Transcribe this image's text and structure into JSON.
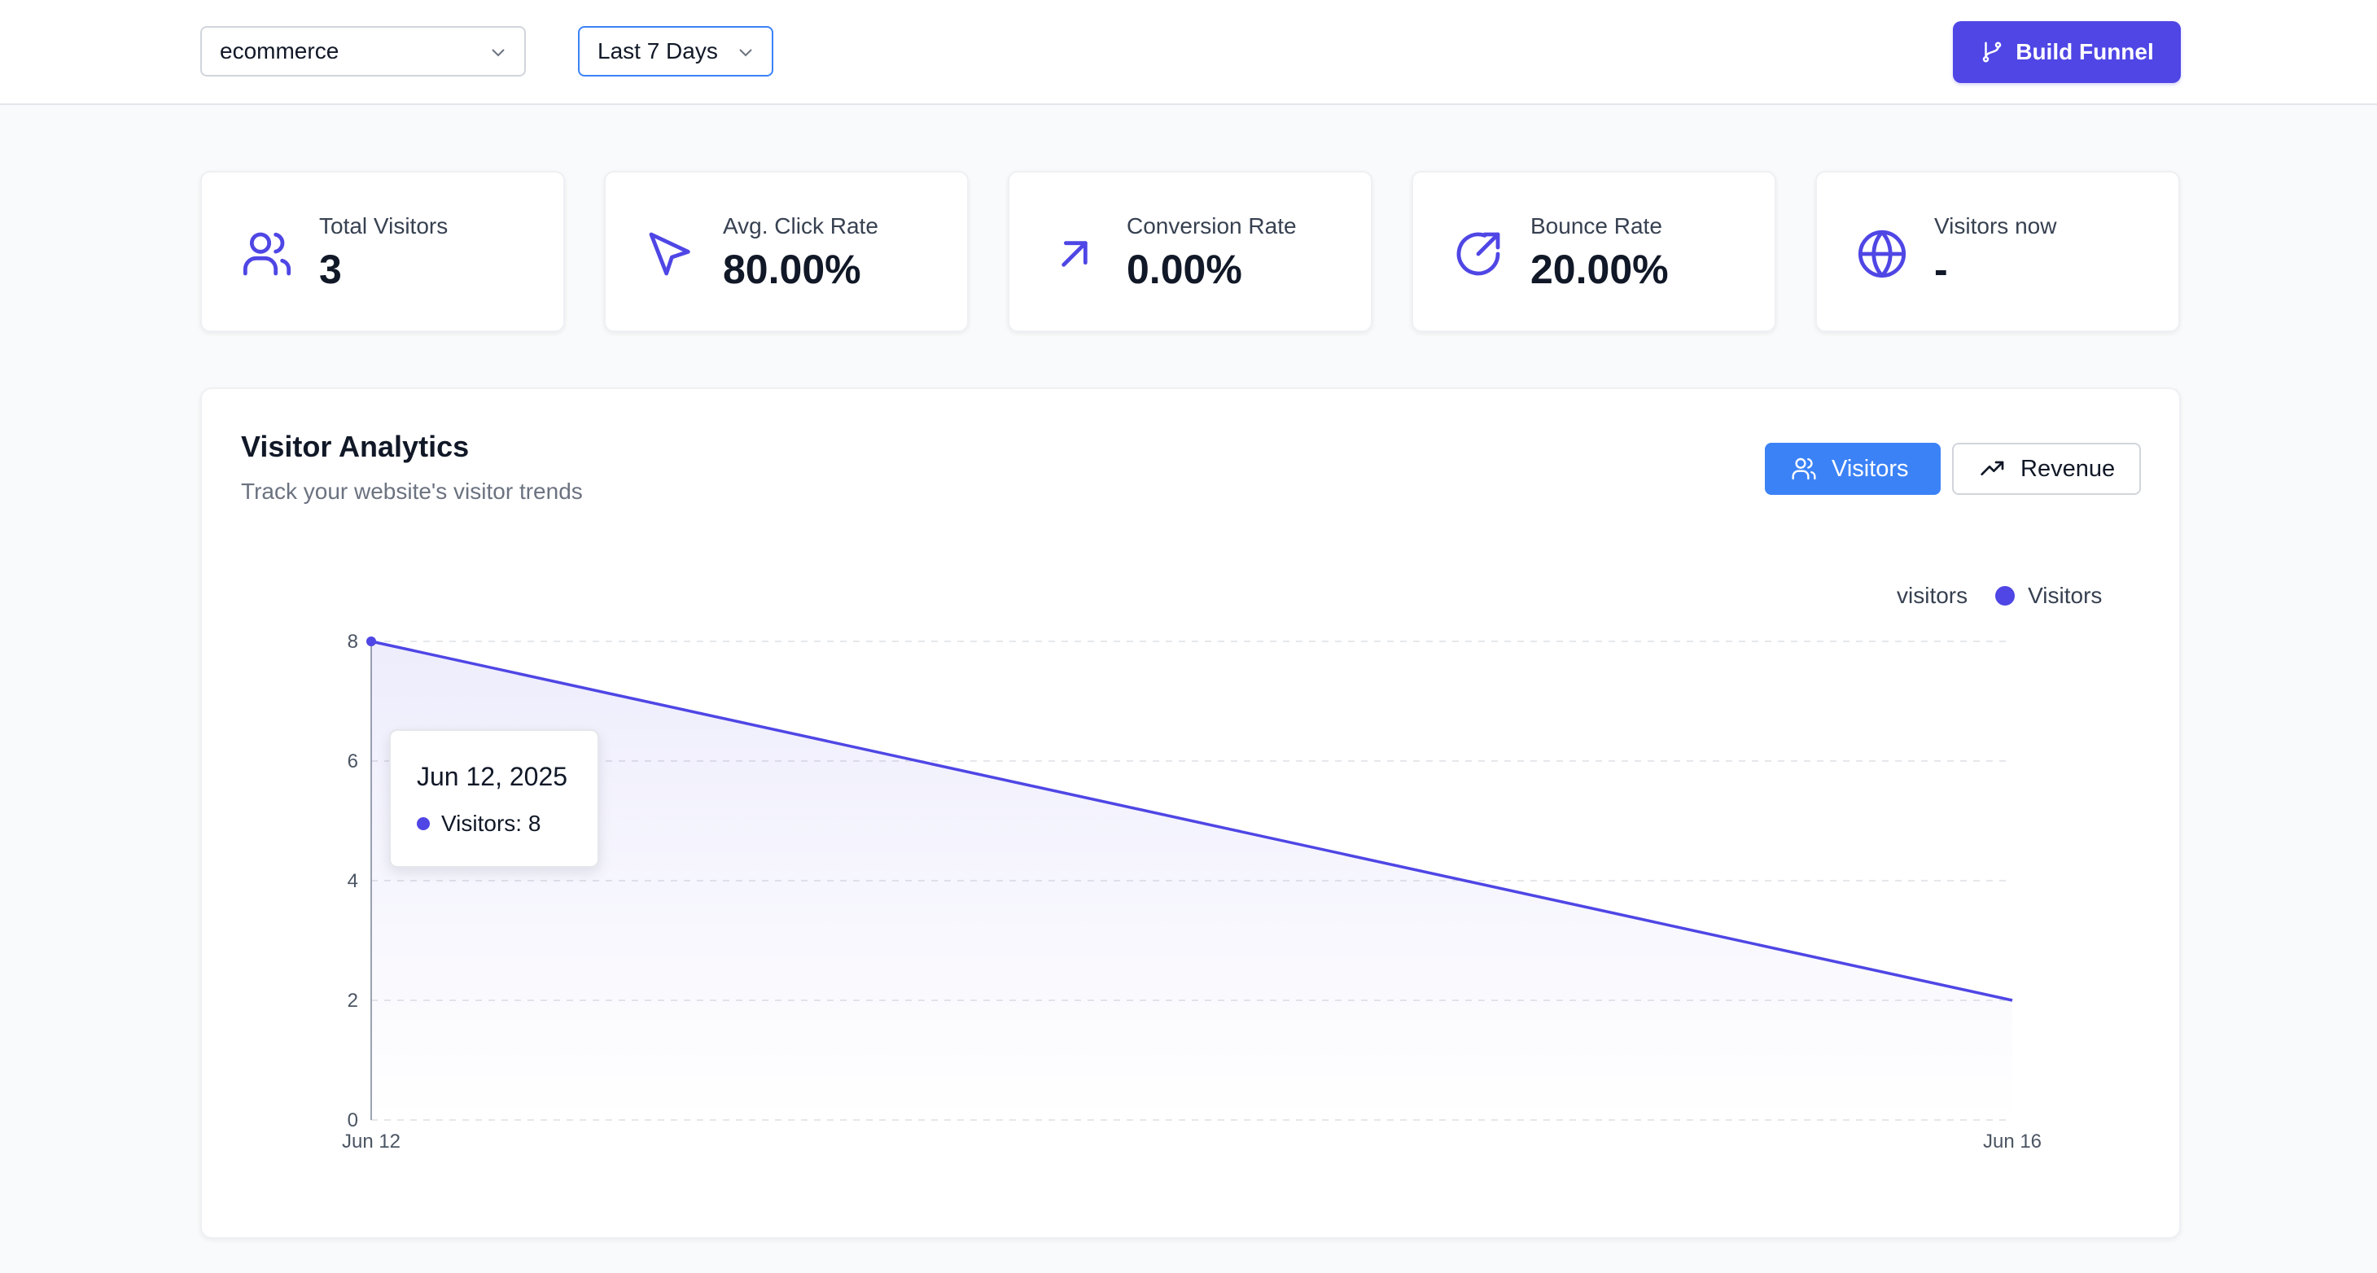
{
  "header": {
    "site_select": "ecommerce",
    "range_select": "Last 7 Days",
    "build_funnel_label": "Build Funnel"
  },
  "stats": [
    {
      "label": "Total Visitors",
      "value": "3",
      "icon": "users-icon"
    },
    {
      "label": "Avg. Click Rate",
      "value": "80.00%",
      "icon": "cursor-icon"
    },
    {
      "label": "Conversion Rate",
      "value": "0.00%",
      "icon": "arrow-up-right-icon"
    },
    {
      "label": "Bounce Rate",
      "value": "20.00%",
      "icon": "share-circle-icon"
    },
    {
      "label": "Visitors now",
      "value": "-",
      "icon": "globe-icon"
    }
  ],
  "analytics": {
    "title": "Visitor Analytics",
    "subtitle": "Track your website's visitor trends",
    "toggle_visitors": "Visitors",
    "toggle_revenue": "Revenue",
    "active_toggle": "Visitors"
  },
  "colors": {
    "accent": "#4f46e5",
    "toggle_active": "#3b82f6"
  },
  "tooltip": {
    "date": "Jun 12, 2025",
    "text": "Visitors: 8"
  },
  "chart_data": {
    "type": "area",
    "x": [
      "Jun 12",
      "Jun 16"
    ],
    "series": [
      {
        "name": "Visitors",
        "values": [
          8,
          2
        ]
      }
    ],
    "legend_key": "visitors",
    "legend_placement": "top-right",
    "yticks": [
      "0",
      "2",
      "4",
      "6",
      "8"
    ],
    "ylim": [
      0,
      8
    ],
    "grid": true
  }
}
